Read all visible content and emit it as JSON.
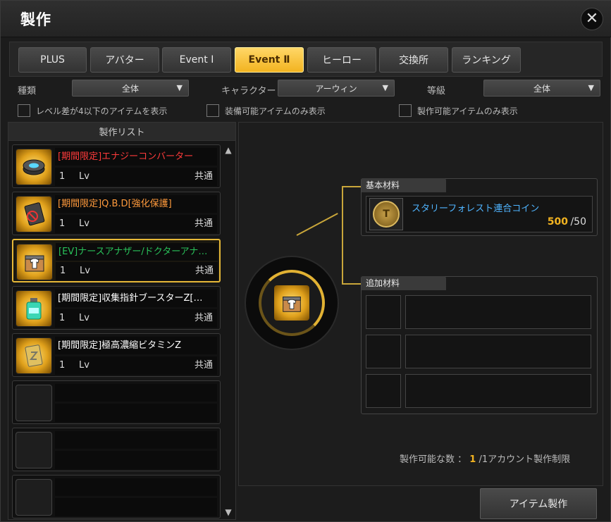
{
  "window": {
    "title": "製作",
    "close_label": "✕"
  },
  "tabs": [
    {
      "label": "PLUS",
      "active": false
    },
    {
      "label": "アバター",
      "active": false
    },
    {
      "label": "Event Ⅰ",
      "active": false
    },
    {
      "label": "Event Ⅱ",
      "active": true
    },
    {
      "label": "ヒーロー",
      "active": false
    },
    {
      "label": "交換所",
      "active": false
    },
    {
      "label": "ランキング",
      "active": false
    }
  ],
  "filters": {
    "type_label": "種類",
    "type_value": "全体",
    "character_label": "キャラクター",
    "character_value": "アーウィン",
    "grade_label": "等級",
    "grade_value": "全体"
  },
  "checks": [
    {
      "label": "レベル差が4以下のアイテムを表示"
    },
    {
      "label": "装備可能アイテムのみ表示"
    },
    {
      "label": "製作可能アイテムのみ表示"
    }
  ],
  "list": {
    "header": "製作リスト",
    "scroll_up": "▲",
    "scroll_down": "▼",
    "items": [
      {
        "name": "[期間限定]エナジーコンバーター",
        "name_color": "#ff3b3b",
        "level": "1",
        "lv_label": "Lv",
        "class": "共通",
        "icon": "energy-converter-icon"
      },
      {
        "name": "[期間限定]Q.B.D[強化保護]",
        "name_color": "#ff9a3c",
        "level": "1",
        "lv_label": "Lv",
        "class": "共通",
        "icon": "qbd-card-icon"
      },
      {
        "name": "[EV]ナースアナザー/ドクターアナ…",
        "name_color": "#29c25a",
        "level": "1",
        "lv_label": "Lv",
        "class": "共通",
        "icon": "costume-box-icon"
      },
      {
        "name": "[期間限定]収集指針ブースターZ[…",
        "name_color": "#ffffff",
        "level": "1",
        "lv_label": "Lv",
        "class": "共通",
        "icon": "booster-bottle-icon"
      },
      {
        "name": "[期間限定]極高濃縮ビタミンZ",
        "name_color": "#ffffff",
        "level": "1",
        "lv_label": "Lv",
        "class": "共通",
        "icon": "vitamin-pack-icon"
      }
    ]
  },
  "materials": {
    "basic_label": "基本材料",
    "basic_item_name": "スタリーフォレスト連合コイン",
    "basic_have": "500",
    "basic_need": "/50",
    "extra_label": "追加材料"
  },
  "craft": {
    "count_label": "製作可能な数 ：",
    "count_value": "1",
    "count_limit": "/1アカウント製作制限",
    "button_label": "アイテム製作"
  }
}
